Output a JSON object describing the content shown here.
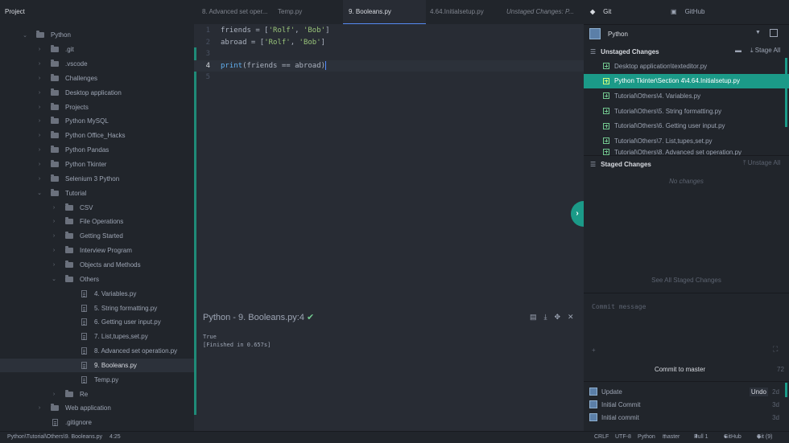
{
  "tree": {
    "header": "Project",
    "items": [
      {
        "label": "Python",
        "kind": "folder",
        "depth": 0,
        "open": true
      },
      {
        "label": ".git",
        "kind": "folder",
        "depth": 1,
        "open": false
      },
      {
        "label": ".vscode",
        "kind": "folder",
        "depth": 1,
        "open": false
      },
      {
        "label": "Challenges",
        "kind": "folder",
        "depth": 1,
        "open": false
      },
      {
        "label": "Desktop application",
        "kind": "folder",
        "depth": 1,
        "open": false
      },
      {
        "label": "Projects",
        "kind": "folder",
        "depth": 1,
        "open": false
      },
      {
        "label": "Python MySQL",
        "kind": "folder",
        "depth": 1,
        "open": false
      },
      {
        "label": "Python Office_Hacks",
        "kind": "folder",
        "depth": 1,
        "open": false
      },
      {
        "label": "Python Pandas",
        "kind": "folder",
        "depth": 1,
        "open": false
      },
      {
        "label": "Python Tkinter",
        "kind": "folder",
        "depth": 1,
        "open": false
      },
      {
        "label": "Selenium 3 Python",
        "kind": "folder",
        "depth": 1,
        "open": false
      },
      {
        "label": "Tutorial",
        "kind": "folder",
        "depth": 1,
        "open": true
      },
      {
        "label": "CSV",
        "kind": "folder",
        "depth": 2,
        "open": false
      },
      {
        "label": "File Operations",
        "kind": "folder",
        "depth": 2,
        "open": false
      },
      {
        "label": "Getting Started",
        "kind": "folder",
        "depth": 2,
        "open": false
      },
      {
        "label": "Interview Program",
        "kind": "folder",
        "depth": 2,
        "open": false
      },
      {
        "label": "Objects and Methods",
        "kind": "folder",
        "depth": 2,
        "open": false
      },
      {
        "label": "Others",
        "kind": "folder",
        "depth": 2,
        "open": true
      },
      {
        "label": "4. Variables.py",
        "kind": "file",
        "depth": 3
      },
      {
        "label": "5. String formatting.py",
        "kind": "file",
        "depth": 3
      },
      {
        "label": "6. Getting user input.py",
        "kind": "file",
        "depth": 3
      },
      {
        "label": "7. List,tupes,set.py",
        "kind": "file",
        "depth": 3
      },
      {
        "label": "8. Advanced set operation.py",
        "kind": "file",
        "depth": 3
      },
      {
        "label": "9. Booleans.py",
        "kind": "file",
        "depth": 3,
        "selected": true
      },
      {
        "label": "Temp.py",
        "kind": "file",
        "depth": 3
      },
      {
        "label": "Re",
        "kind": "folder",
        "depth": 2,
        "open": false
      },
      {
        "label": "Web application",
        "kind": "folder",
        "depth": 1,
        "open": false
      },
      {
        "label": ".gitignore",
        "kind": "file",
        "depth": 1
      }
    ]
  },
  "tabs": [
    {
      "label": "8. Advanced set oper...",
      "active": false,
      "italic": false
    },
    {
      "label": "Temp.py",
      "active": false,
      "italic": false
    },
    {
      "label": "9. Booleans.py",
      "active": true,
      "italic": false
    },
    {
      "label": "4.64.Initialsetup.py",
      "active": false,
      "italic": false
    },
    {
      "label": "Unstaged Changes: P...",
      "active": false,
      "italic": true
    }
  ],
  "editor": {
    "lines": [
      {
        "n": "1",
        "tokens": [
          {
            "t": "friends = [",
            "c": ""
          },
          {
            "t": "'Rolf'",
            "c": "str"
          },
          {
            "t": ", ",
            "c": ""
          },
          {
            "t": "'Bob'",
            "c": "str"
          },
          {
            "t": "]",
            "c": ""
          }
        ]
      },
      {
        "n": "2",
        "tokens": [
          {
            "t": "abroad = [",
            "c": ""
          },
          {
            "t": "'Rolf'",
            "c": "str"
          },
          {
            "t": ", ",
            "c": ""
          },
          {
            "t": "'Bob'",
            "c": "str"
          },
          {
            "t": "]",
            "c": ""
          }
        ]
      },
      {
        "n": "3",
        "tokens": []
      },
      {
        "n": "4",
        "tokens": [
          {
            "t": "print",
            "c": "fn"
          },
          {
            "t": "(friends == abroad)",
            "c": ""
          }
        ],
        "current": true
      },
      {
        "n": "5",
        "tokens": []
      }
    ]
  },
  "output": {
    "title": "Python - 9. Booleans.py:4",
    "check_glyph": "✔",
    "text": "True\n[Finished in 0.657s]",
    "tools": [
      "▤",
      "⤓",
      "✥",
      "✕"
    ]
  },
  "git": {
    "tab_git": "Git",
    "tab_github": "GitHub",
    "repo": "Python",
    "unstaged_title": "Unstaged Changes",
    "stage_all": "Stage All",
    "unstaged": [
      {
        "label": "Desktop application\\texteditor.py",
        "selected": false
      },
      {
        "label": "Python Tkinter\\Section 4\\4.64.Initialsetup.py",
        "selected": true
      },
      {
        "label": "Tutorial\\Others\\4. Variables.py",
        "selected": false
      },
      {
        "label": "Tutorial\\Others\\5. String formatting.py",
        "selected": false
      },
      {
        "label": "Tutorial\\Others\\6. Getting user input.py",
        "selected": false
      },
      {
        "label": "Tutorial\\Others\\7. List,tupes,set.py",
        "selected": false
      },
      {
        "label": "Tutorial\\Others\\8. Advanced set operation.py",
        "selected": false
      }
    ],
    "staged_title": "Staged Changes",
    "unstage_all": "Unstage All",
    "no_changes": "No changes",
    "see_all_staged": "See All Staged Changes",
    "commit_placeholder": "Commit message",
    "commit_button": "Commit to master",
    "char_count": "72",
    "commits": [
      {
        "message": "Update",
        "time": "2d",
        "undo": "Undo"
      },
      {
        "message": "Initial Commit",
        "time": "3d"
      },
      {
        "message": "Initial commit",
        "time": "3d"
      }
    ]
  },
  "status": {
    "path": "Python\\Tutorial\\Others\\9. Booleans.py",
    "cursor": "4:25",
    "line_ending": "CRLF",
    "encoding": "UTF-8",
    "grammar": "Python",
    "branch": "master",
    "pull": "Pull 1",
    "github": "GitHub",
    "git": "Git (9)"
  },
  "colors": {
    "accent_teal": "#1b9a88",
    "string_green": "#98c379",
    "function_blue": "#61afef",
    "success_green": "#73c990"
  }
}
